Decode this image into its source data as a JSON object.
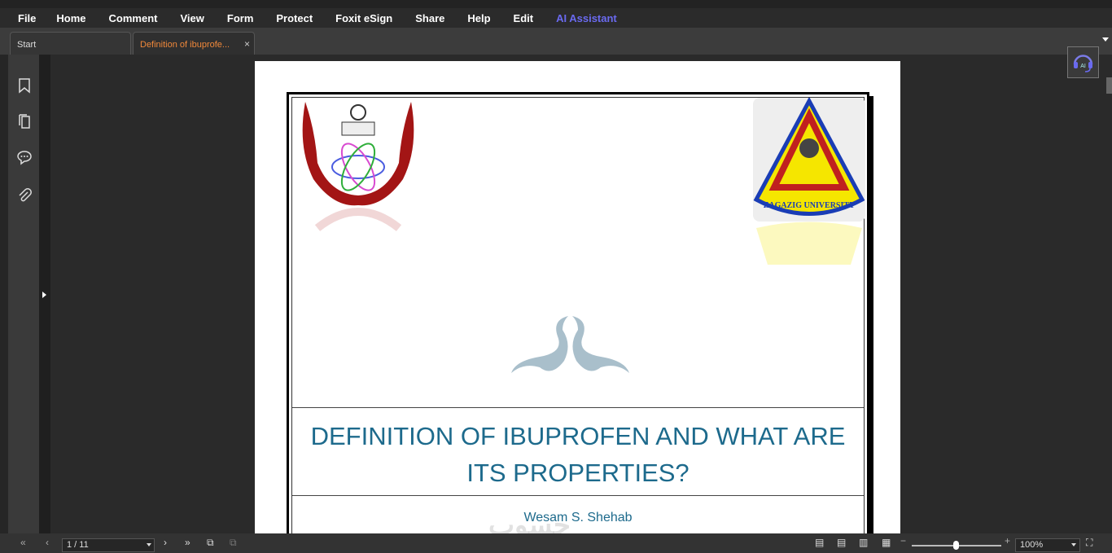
{
  "menu": [
    "File",
    "Home",
    "Comment",
    "View",
    "Form",
    "Protect",
    "Foxit eSign",
    "Share",
    "Help",
    "Edit",
    "AI Assistant"
  ],
  "colors": {
    "ai_assistant": "#6a6af0",
    "active_tab": "#f0883a",
    "title": "#1d6a8c"
  },
  "tabs": [
    {
      "label": "Start"
    },
    {
      "label": "Definition of ibuprofe...",
      "close": "×"
    }
  ],
  "sidebar": [
    "bookmark-icon",
    "pages-icon",
    "comment-icon",
    "attachment-icon"
  ],
  "document": {
    "title": "DEFINITION OF IBUPROFEN AND WHAT ARE ITS PROPERTIES?",
    "author": "Wesam S. Shehab",
    "logo_right_text": "ZAGAZIG UNIVERSITY",
    "watermark": "حسوب"
  },
  "status": {
    "page": "1 / 11",
    "zoom": "100%",
    "zoom_level_percent": 50
  }
}
